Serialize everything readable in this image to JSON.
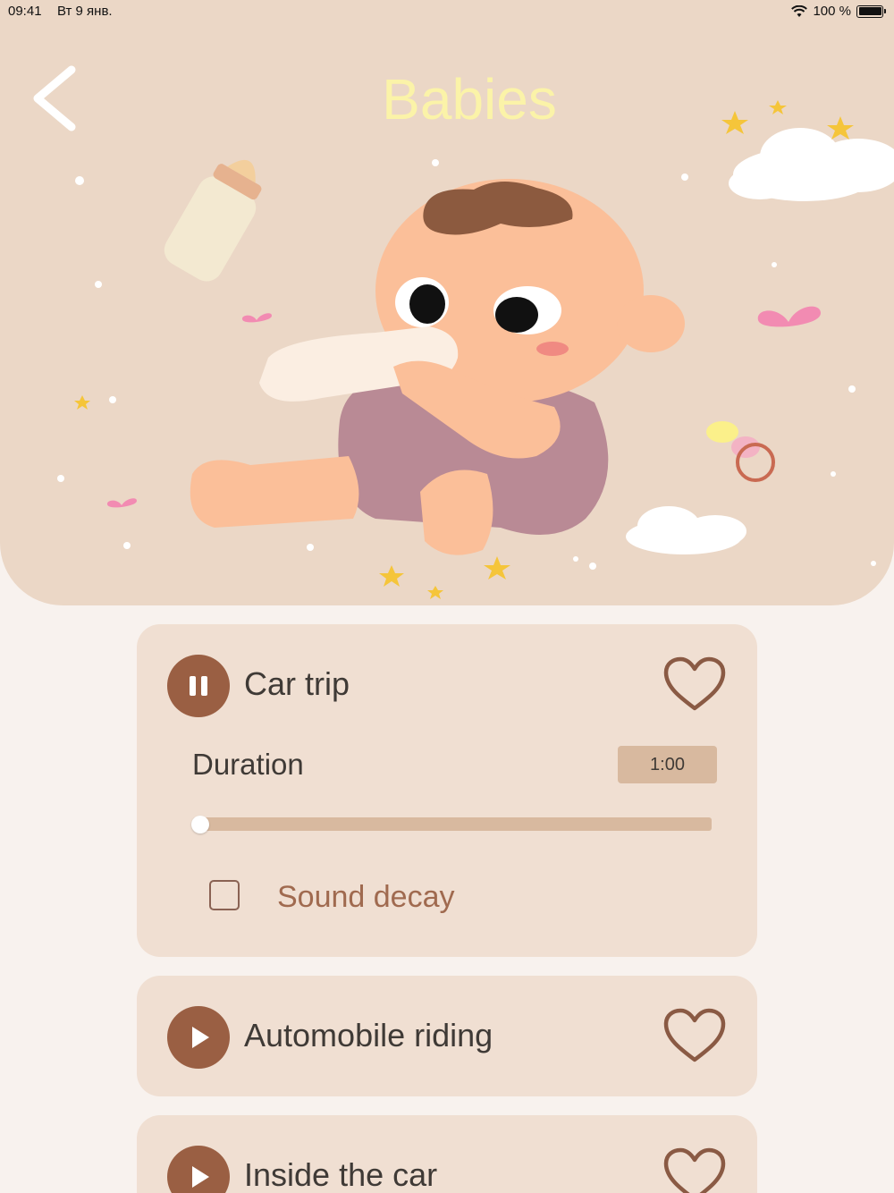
{
  "status_bar": {
    "time": "09:41",
    "date": "Вт 9 янв.",
    "battery": "100 %"
  },
  "header": {
    "title": "Babies",
    "title_color": "#fbf3a8",
    "background": "#ebd7c6"
  },
  "colors": {
    "accent": "#9a5f43",
    "card": "#f0dfd2",
    "page": "#f8f2ee",
    "track": "#d8b99f"
  },
  "sounds": [
    {
      "title": "Car trip",
      "state": "playing",
      "icon": "pause-icon",
      "expanded": true,
      "favorite": false
    },
    {
      "title": "Automobile riding",
      "state": "stopped",
      "icon": "play-icon",
      "favorite": false
    },
    {
      "title": "Inside the car",
      "state": "stopped",
      "icon": "play-icon",
      "favorite": false
    }
  ],
  "player": {
    "duration_label": "Duration",
    "duration_value": "1:00",
    "slider_fraction": 0.0,
    "sound_decay_label": "Sound decay",
    "sound_decay_checked": false
  }
}
